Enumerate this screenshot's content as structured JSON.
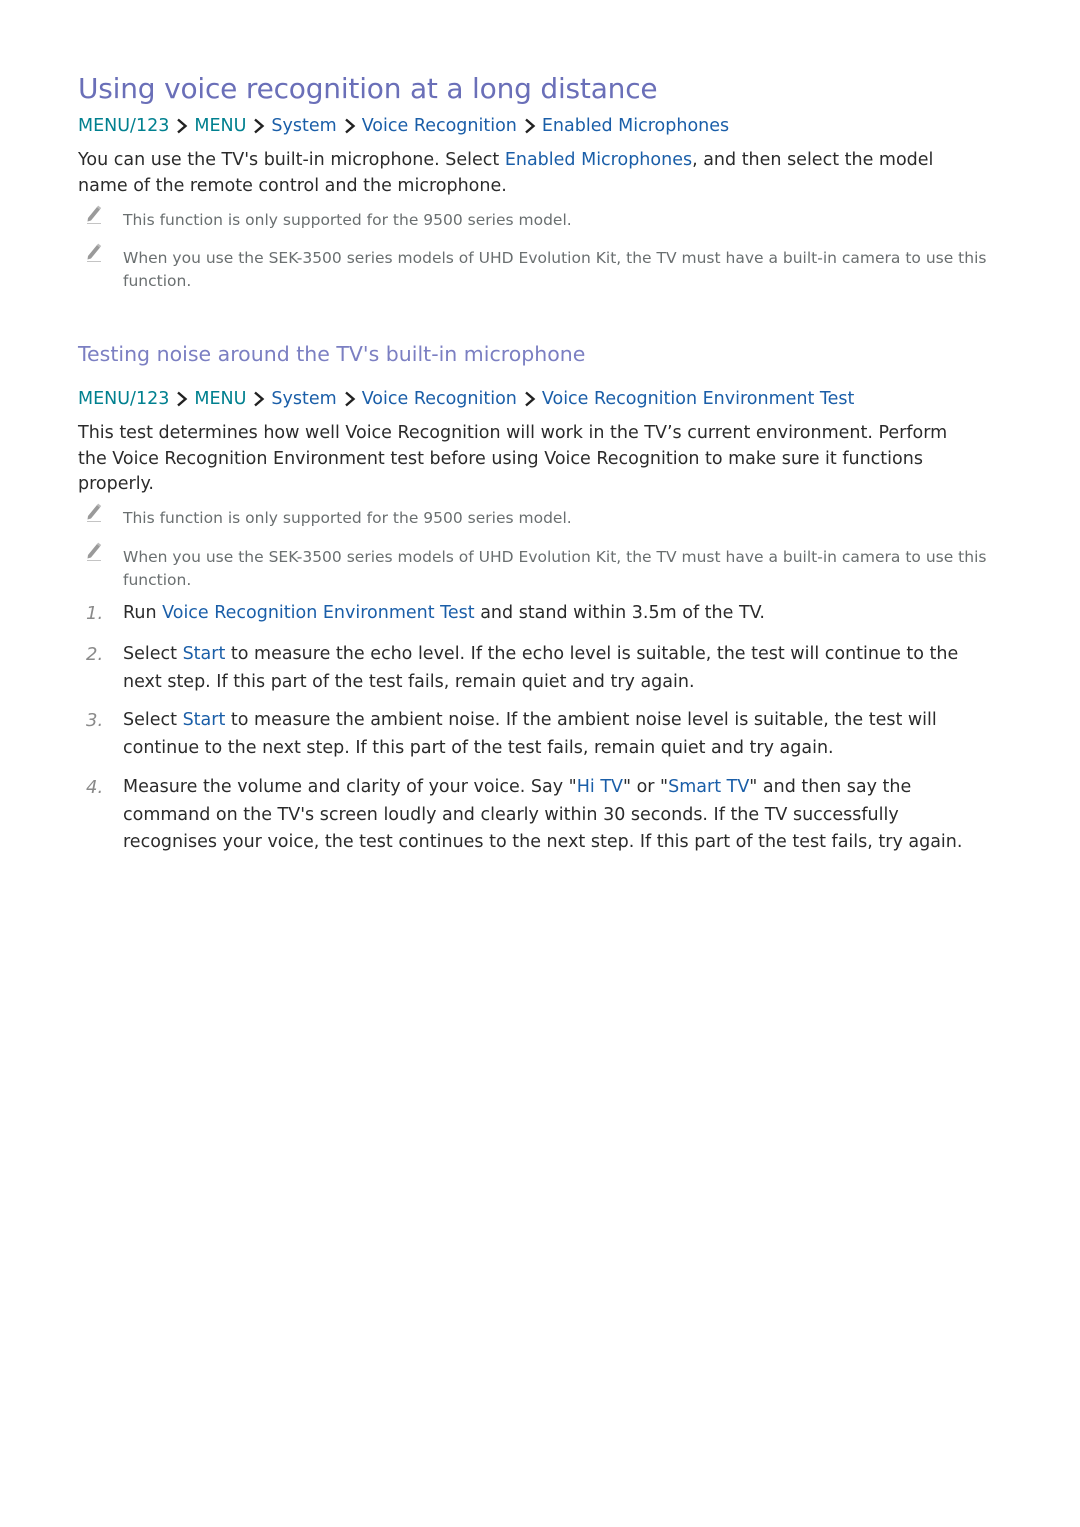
{
  "section1": {
    "title": "Using voice recognition at a long distance",
    "breadcrumb": [
      "MENU/123",
      "MENU",
      "System",
      "Voice Recognition",
      "Enabled Microphones"
    ],
    "body": {
      "before": "You can use the TV's built-in microphone. Select ",
      "highlight": "Enabled Microphones",
      "after": ", and then select the model name of the remote control and the microphone."
    },
    "notes": [
      {
        "icon": "pencil-note-icon",
        "text": "This function is only supported for the 9500 series model."
      },
      {
        "icon": "pencil-note-icon",
        "text": "When you use the SEK-3500 series models of UHD Evolution Kit, the TV must have a built-in camera to use this function."
      }
    ]
  },
  "section2": {
    "title": "Testing noise around the TV's built-in microphone",
    "breadcrumb": [
      "MENU/123",
      "MENU",
      "System",
      "Voice Recognition",
      "Voice Recognition Environment Test"
    ],
    "body": "This test determines how well Voice Recognition will work in the TV’s current environment. Perform the Voice Recognition Environment test before using Voice Recognition to make sure it functions properly.",
    "notes": [
      {
        "icon": "pencil-note-icon",
        "text": "This function is only supported for the 9500 series model."
      },
      {
        "icon": "pencil-note-icon",
        "text": "When you use the SEK-3500 series models of UHD Evolution Kit, the TV must have a built-in camera to use this function."
      }
    ],
    "steps": [
      {
        "num": "1.",
        "parts": [
          [
            "Run ",
            false
          ],
          [
            "Voice Recognition Environment Test",
            true
          ],
          [
            " and stand within 3.5m of the TV.",
            false
          ]
        ]
      },
      {
        "num": "2.",
        "parts": [
          [
            "Select ",
            false
          ],
          [
            "Start",
            true
          ],
          [
            " to measure the echo level. If the echo level is suitable, the test will continue to the next step. If this part of the test fails, remain quiet and try again.",
            false
          ]
        ]
      },
      {
        "num": "3.",
        "parts": [
          [
            "Select ",
            false
          ],
          [
            "Start",
            true
          ],
          [
            " to measure the ambient noise. If the ambient noise level is suitable, the test will continue to the next step. If this part of the test fails, remain quiet and try again.",
            false
          ]
        ]
      },
      {
        "num": "4.",
        "parts": [
          [
            "Measure the volume and clarity of your voice. Say \"",
            false
          ],
          [
            "Hi TV",
            true
          ],
          [
            "\" or \"",
            false
          ],
          [
            "Smart TV",
            true
          ],
          [
            "\" and then say the command on the TV's screen loudly and clearly within 30 seconds. If the TV successfully recognises your voice, the test continues to the next step. If this part of the test fails, try again.",
            false
          ]
        ]
      }
    ]
  },
  "colors": {
    "heading": "#6a6fb8",
    "subheading": "#7b7fc2",
    "link": "#1a5ea8",
    "menu_teal": "#00808f",
    "note_text": "#6a6f70",
    "body_text": "#2b2b2b"
  }
}
